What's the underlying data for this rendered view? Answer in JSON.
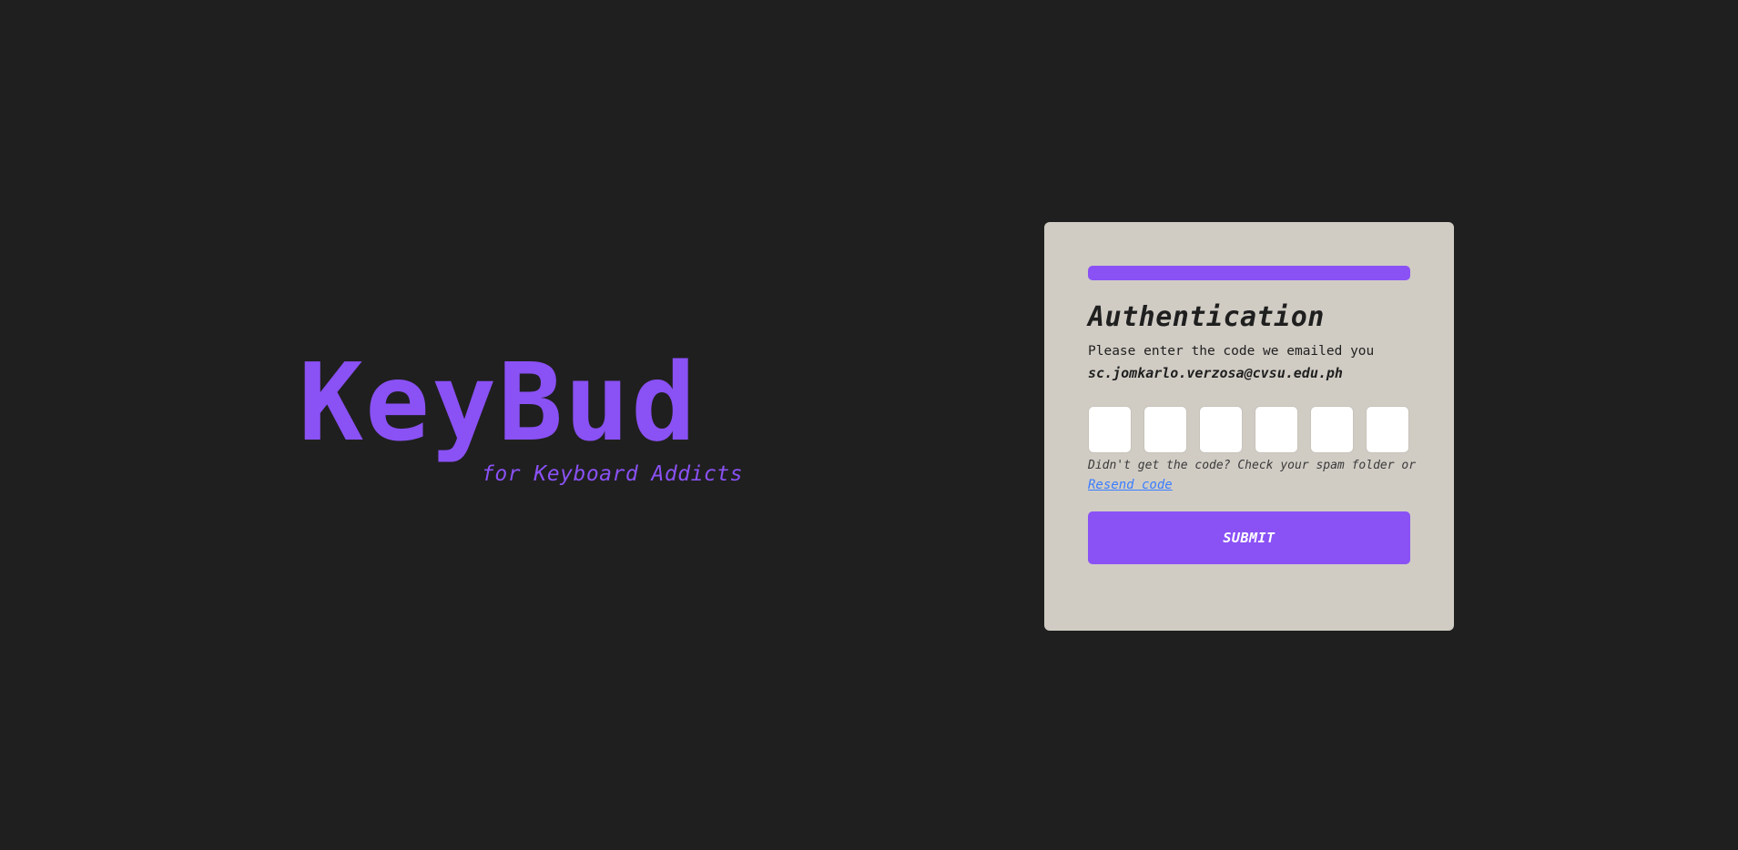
{
  "brand": {
    "title": "KeyBud",
    "tagline": "for Keyboard Addicts"
  },
  "auth": {
    "title": "Authentication",
    "instructions": "Please enter the code we emailed you",
    "email": "sc.jomkarlo.verzosa@cvsu.edu.ph",
    "code_digits": [
      "",
      "",
      "",
      "",
      "",
      ""
    ],
    "helper_text": "Didn't get the code? Check your spam folder or",
    "resend_label": "Resend code",
    "submit_label": "SUBMIT"
  },
  "colors": {
    "background": "#1f1f1f",
    "accent": "#8a51f5",
    "card": "#d0ccc4",
    "link": "#3a7dff"
  }
}
